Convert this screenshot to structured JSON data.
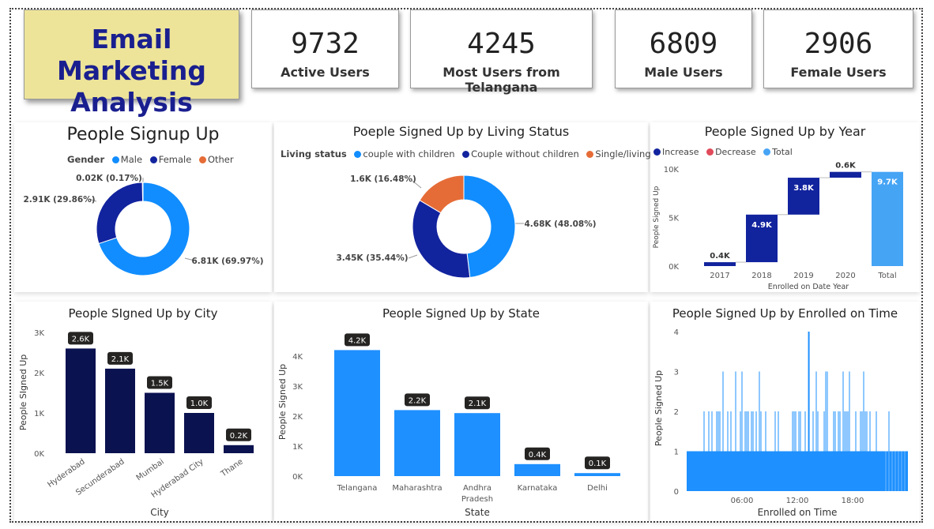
{
  "dashboard": {
    "title_line1": "Email Marketing",
    "title_line2": "Analysis"
  },
  "kpis": [
    {
      "value": "9732",
      "label": "Active Users"
    },
    {
      "value": "4245",
      "label": "Most Users from Telangana"
    },
    {
      "value": "6809",
      "label": "Male Users"
    },
    {
      "value": "2906",
      "label": "Female Users"
    }
  ],
  "colors": {
    "male": "#118dff",
    "female": "#12239e",
    "other": "#e66c37",
    "navy": "#0b1250",
    "blue": "#1e90ff",
    "total": "#46a4f5",
    "decrease": "#e04a5a"
  },
  "chart_data": [
    {
      "type": "pie",
      "title": "People Signup Up",
      "legend_title": "Gender",
      "categories": [
        "Male",
        "Female",
        "Other"
      ],
      "values": [
        6.81,
        2.91,
        0.02
      ],
      "labels": [
        "6.81K (69.97%)",
        "2.91K (29.86%)",
        "0.02K (0.17%)"
      ]
    },
    {
      "type": "pie",
      "title": "Poeple Signed Up by Living Status",
      "legend_title": "Living status",
      "categories": [
        "couple with children",
        "Couple without children",
        "Single/living alone"
      ],
      "values": [
        4.68,
        3.45,
        1.6
      ],
      "labels": [
        "4.68K (48.08%)",
        "3.45K (35.44%)",
        "1.6K (16.48%)"
      ]
    },
    {
      "type": "bar",
      "subtype": "waterfall",
      "title": "People Signed Up by Year",
      "legend": [
        "Increase",
        "Decrease",
        "Total"
      ],
      "categories": [
        "2017",
        "2018",
        "2019",
        "2020",
        "Total"
      ],
      "values": [
        0.4,
        4.9,
        3.8,
        0.6,
        9.7
      ],
      "labels": [
        "0.4K",
        "4.9K",
        "3.8K",
        "0.6K",
        "9.7K"
      ],
      "xlabel": "Enrolled on Date Year",
      "ylabel": "People Signed Up",
      "yticks": [
        "0K",
        "5K",
        "10K"
      ],
      "ylim": [
        0,
        10
      ]
    },
    {
      "type": "bar",
      "title": "People SIgned Up by City",
      "categories": [
        "Hyderabad",
        "Secunderabad",
        "Mumbai",
        "Hyderabad City",
        "Thane"
      ],
      "values": [
        2.6,
        2.1,
        1.5,
        1.0,
        0.2
      ],
      "labels": [
        "2.6K",
        "2.1K",
        "1.5K",
        "1.0K",
        "0.2K"
      ],
      "xlabel": "City",
      "ylabel": "People SIgned Up",
      "yticks": [
        "0K",
        "1K",
        "2K",
        "3K"
      ],
      "ylim": [
        0,
        3
      ]
    },
    {
      "type": "bar",
      "title": "People Signed Up by State",
      "categories": [
        "Telangana",
        "Maharashtra",
        "Andhra Pradesh",
        "Karnataka",
        "Delhi"
      ],
      "values": [
        4.2,
        2.2,
        2.1,
        0.4,
        0.1
      ],
      "labels": [
        "4.2K",
        "2.2K",
        "2.1K",
        "0.4K",
        "0.1K"
      ],
      "xlabel": "State",
      "ylabel": "People Signed Up",
      "yticks": [
        "0K",
        "1K",
        "2K",
        "3K",
        "4K"
      ],
      "ylim": [
        0,
        4.5
      ]
    },
    {
      "type": "bar",
      "title": "People Signed Up by Enrolled on Time",
      "xlabel": "Enrolled on Time",
      "ylabel": "People Signed Up",
      "xticks": [
        "06:00",
        "12:00",
        "18:00"
      ],
      "yticks": [
        "0",
        "1",
        "2",
        "3",
        "4"
      ],
      "ylim": [
        0,
        4
      ],
      "baseline_count": 1,
      "max_count": 4,
      "max_at": "13:15"
    }
  ]
}
